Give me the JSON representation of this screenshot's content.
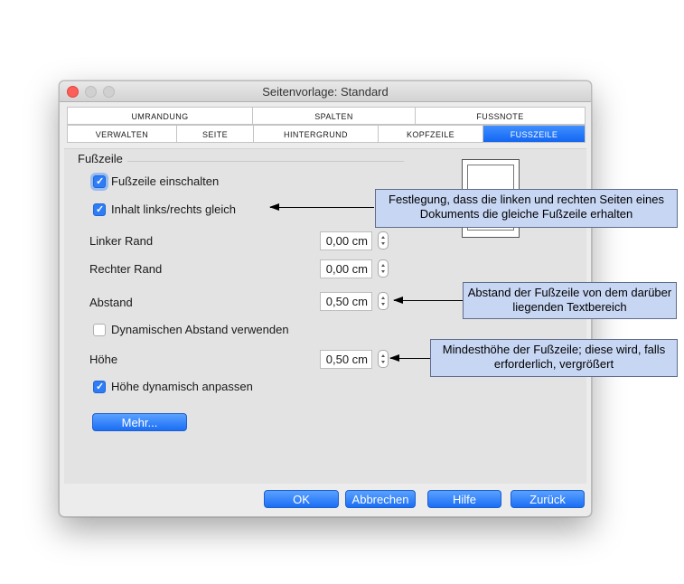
{
  "window": {
    "title": "Seitenvorlage: Standard"
  },
  "tabs_row1": [
    "Umrandung",
    "Spalten",
    "Fussnote"
  ],
  "tabs_row2": [
    "Verwalten",
    "Seite",
    "Hintergrund",
    "Kopfzeile",
    "Fusszeile"
  ],
  "active_tab": "Fusszeile",
  "section": {
    "title": "Fußzeile",
    "enable_footer": {
      "label": "Fußzeile einschalten",
      "checked": true
    },
    "same_content": {
      "label": "Inhalt links/rechts gleich",
      "checked": true
    },
    "left_margin": {
      "label": "Linker Rand",
      "value": "0,00 cm"
    },
    "right_margin": {
      "label": "Rechter Rand",
      "value": "0,00 cm"
    },
    "spacing": {
      "label": "Abstand",
      "value": "0,50 cm"
    },
    "dynamic_spacing": {
      "label": "Dynamischen Abstand verwenden",
      "checked": false
    },
    "height": {
      "label": "Höhe",
      "value": "0,50 cm"
    },
    "autofit_height": {
      "label": "Höhe dynamisch anpassen",
      "checked": true
    },
    "more_button": "Mehr..."
  },
  "footer_buttons": {
    "ok": "OK",
    "cancel": "Abbrechen",
    "help": "Hilfe",
    "back": "Zurück"
  },
  "callouts": {
    "same_content": "Festlegung, dass die linken und rechten Seiten eines Dokuments die gleiche Fußzeile erhalten",
    "spacing": "Abstand der Fußzeile von dem darüber liegenden Textbereich",
    "height": "Mindesthöhe der Fußzeile; diese wird, falls erforderlich, vergrößert"
  },
  "colors": {
    "accent": "#1b6ef5",
    "callout_bg": "#c7d6f3",
    "close_light": "#fc5f57"
  }
}
